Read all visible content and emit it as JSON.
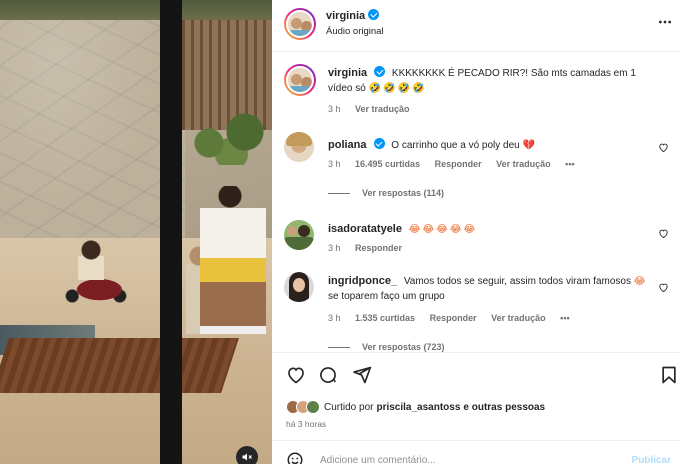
{
  "post": {
    "username": "virginia",
    "audio": "Áudio original",
    "more_icon": "more-horizontal-icon"
  },
  "caption": {
    "username": "virginia",
    "text": "KKKKKKKK É PECADO RIR?! São mts camadas em 1 vídeo só",
    "emojis": "🤣🤣🤣🤣",
    "time": "3 h",
    "translate": "Ver tradução"
  },
  "comments": [
    {
      "username": "poliana",
      "verified": true,
      "text": "O carrinho que a vó poly deu",
      "emoji": "💔",
      "time": "3 h",
      "likes": "16.495 curtidas",
      "reply": "Responder",
      "translate": "Ver tradução",
      "more": "•••",
      "replies": "Ver respostas (114)"
    },
    {
      "username": "isadoratatyele",
      "verified": false,
      "text": "",
      "emoji": "😂😂😂😂😂",
      "time": "3 h",
      "reply": "Responder"
    },
    {
      "username": "ingridponce_",
      "verified": false,
      "text": "Vamos todos se seguir, assim todos viram famosos",
      "emoji": "😂",
      "text2": "se toparem faço um grupo",
      "time": "3 h",
      "likes": "1.535 curtidas",
      "reply": "Responder",
      "translate": "Ver tradução",
      "more": "•••",
      "replies": "Ver respostas (723)"
    }
  ],
  "actions": {
    "like_icon": "heart-icon",
    "comment_icon": "comment-icon",
    "share_icon": "send-icon",
    "save_icon": "bookmark-icon"
  },
  "liked_by": {
    "prefix": "Curtido por",
    "user": "priscila_asantoss",
    "suffix": "e outras pessoas"
  },
  "posted_time": "há 3 horas",
  "add_comment": {
    "placeholder": "Adicione um comentário...",
    "publish": "Publicar"
  },
  "colors": {
    "verified": "#0095f6",
    "secondary_text": "#737373",
    "publish_disabled": "#b2dffc"
  }
}
